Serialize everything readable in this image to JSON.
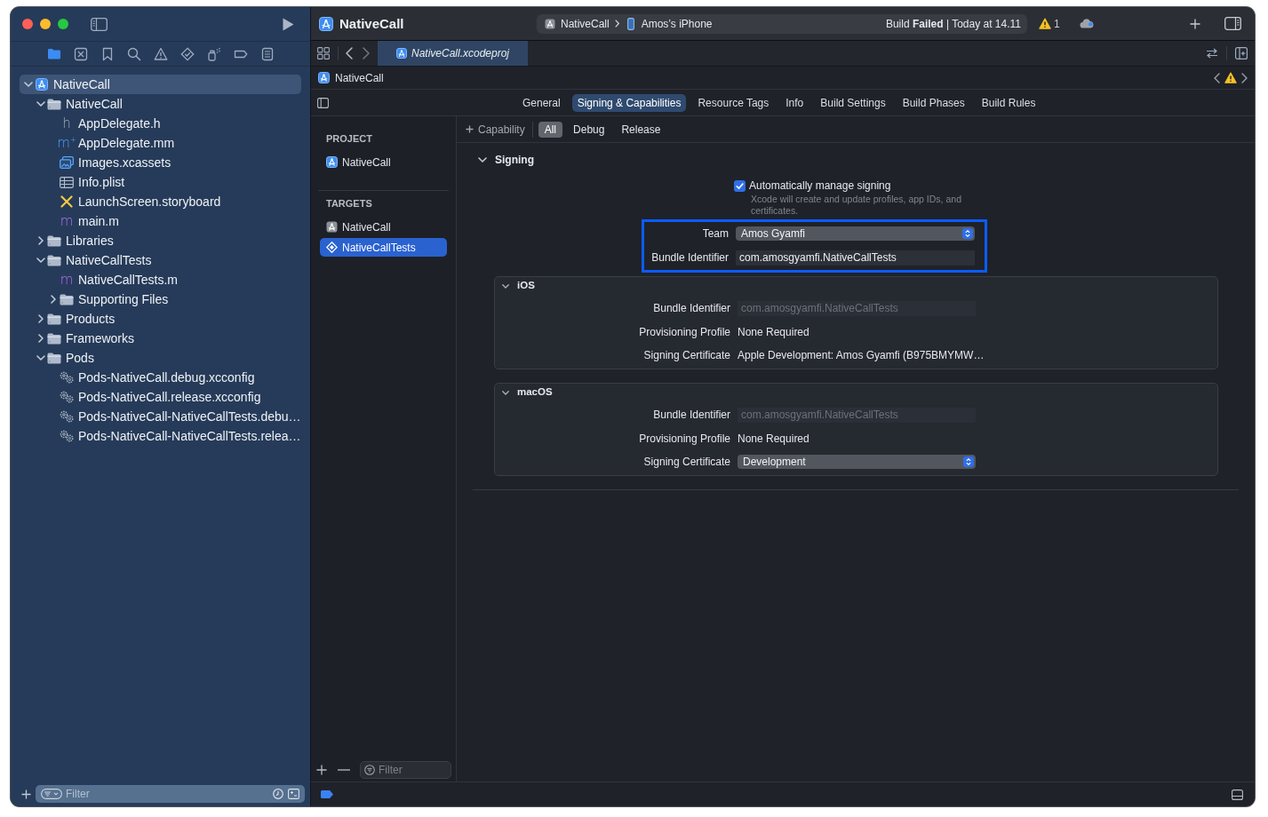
{
  "window": {
    "title": "NativeCall"
  },
  "toolbar": {
    "scheme": "NativeCall",
    "destination": "Amos’s iPhone",
    "status": "Build **Failed** | Today at 14.11",
    "warning_count": "1"
  },
  "navigator": {
    "tabs": [
      {
        "kind": "project",
        "selected": true
      },
      {
        "kind": "source_control",
        "selected": false
      },
      {
        "kind": "bookmarks",
        "selected": false
      },
      {
        "kind": "find",
        "selected": false
      },
      {
        "kind": "issues",
        "selected": false
      },
      {
        "kind": "tests",
        "selected": false
      },
      {
        "kind": "debug",
        "selected": false
      },
      {
        "kind": "breakpoints",
        "selected": false
      },
      {
        "kind": "reports",
        "selected": false
      }
    ],
    "tree": [
      {
        "label": "NativeCall",
        "kind": "project",
        "selected": true,
        "expanded": true,
        "children": [
          {
            "label": "NativeCall",
            "kind": "folder",
            "selected": false,
            "expanded": true,
            "children": [
              {
                "label": "AppDelegate.h",
                "kind": "header",
                "glyph": "h",
                "selected": false
              },
              {
                "label": "AppDelegate.mm",
                "kind": "objcpp",
                "glyph": "m$^{+}$",
                "selected": false
              },
              {
                "label": "Images.xcassets",
                "kind": "assets",
                "selected": false
              },
              {
                "label": "Info.plist",
                "kind": "plist",
                "selected": false
              },
              {
                "label": "LaunchScreen.storyboard",
                "kind": "storyboard",
                "selected": false
              },
              {
                "label": "main.m",
                "kind": "objc",
                "glyph": "m",
                "selected": false
              }
            ]
          },
          {
            "label": "Libraries",
            "kind": "folder",
            "selected": false,
            "expanded": false
          },
          {
            "label": "NativeCallTests",
            "kind": "folder",
            "selected": false,
            "expanded": true,
            "children": [
              {
                "label": "NativeCallTests.m",
                "kind": "objc",
                "glyph": "m",
                "selected": false
              },
              {
                "label": "Supporting Files",
                "kind": "folder",
                "selected": false,
                "expanded": false
              }
            ]
          },
          {
            "label": "Products",
            "kind": "folder",
            "selected": false,
            "expanded": false
          },
          {
            "label": "Frameworks",
            "kind": "folder",
            "selected": false,
            "expanded": false
          },
          {
            "label": "Pods",
            "kind": "folder",
            "selected": false,
            "expanded": true,
            "children": [
              {
                "label": "Pods-NativeCall.debug.xcconfig",
                "kind": "config",
                "selected": false
              },
              {
                "label": "Pods-NativeCall.release.xcconfig",
                "kind": "config",
                "selected": false
              },
              {
                "label": "Pods-NativeCall-NativeCallTests.debu…",
                "kind": "config",
                "selected": false
              },
              {
                "label": "Pods-NativeCall-NativeCallTests.relea…",
                "kind": "config",
                "selected": false
              }
            ]
          }
        ]
      }
    ],
    "filter_placeholder": "Filter"
  },
  "editor": {
    "tab": {
      "label": "NativeCall.xcodeproj",
      "selected": true
    },
    "jump_bar": {
      "label": "NativeCall"
    },
    "settings_tabs": [
      {
        "label": "General",
        "selected": false
      },
      {
        "label": "Signing & Capabilities",
        "selected": true
      },
      {
        "label": "Resource Tags",
        "selected": false
      },
      {
        "label": "Info",
        "selected": false
      },
      {
        "label": "Build Settings",
        "selected": false
      },
      {
        "label": "Build Phases",
        "selected": false
      },
      {
        "label": "Build Rules",
        "selected": false
      }
    ],
    "targets": {
      "sections": [
        {
          "heading": "PROJECT",
          "items": [
            {
              "label": "NativeCall",
              "kind": "project",
              "selected": false
            }
          ]
        },
        {
          "heading": "TARGETS",
          "items": [
            {
              "label": "NativeCall",
              "kind": "app",
              "selected": false
            },
            {
              "label": "NativeCallTests",
              "kind": "tests",
              "selected": true
            }
          ]
        }
      ],
      "filter_placeholder": "Filter"
    },
    "capabilities": {
      "add_label": "Capability",
      "configurations": [
        {
          "label": "All",
          "selected": true
        },
        {
          "label": "Debug",
          "selected": false
        },
        {
          "label": "Release",
          "selected": false
        }
      ]
    },
    "signing": {
      "title": "Signing",
      "expanded": true,
      "automatic": {
        "label": "Automatically manage signing",
        "checked": true,
        "note": "Xcode will create and update profiles, app IDs, and certificates."
      },
      "highlighted": true,
      "fields": [
        {
          "label": "Team",
          "kind": "popup",
          "value": "Amos Gyamfi"
        },
        {
          "label": "Bundle Identifier",
          "kind": "text",
          "value": "com.amosgyamfi.NativeCallTests"
        }
      ],
      "platforms": [
        {
          "title": "iOS",
          "expanded": true,
          "fields": [
            {
              "label": "Bundle Identifier",
              "kind": "disabled",
              "value": "com.amosgyamfi.NativeCallTests"
            },
            {
              "label": "Provisioning Profile",
              "kind": "plain",
              "value": "None Required"
            },
            {
              "label": "Signing Certificate",
              "kind": "plain",
              "value": "Apple Development: Amos Gyamfi (B975BMYMW…"
            }
          ]
        },
        {
          "title": "macOS",
          "expanded": true,
          "fields": [
            {
              "label": "Bundle Identifier",
              "kind": "disabled",
              "value": "com.amosgyamfi.NativeCallTests"
            },
            {
              "label": "Provisioning Profile",
              "kind": "plain",
              "value": "None Required"
            },
            {
              "label": "Signing Certificate",
              "kind": "popup",
              "value": "Development"
            }
          ]
        }
      ]
    }
  }
}
